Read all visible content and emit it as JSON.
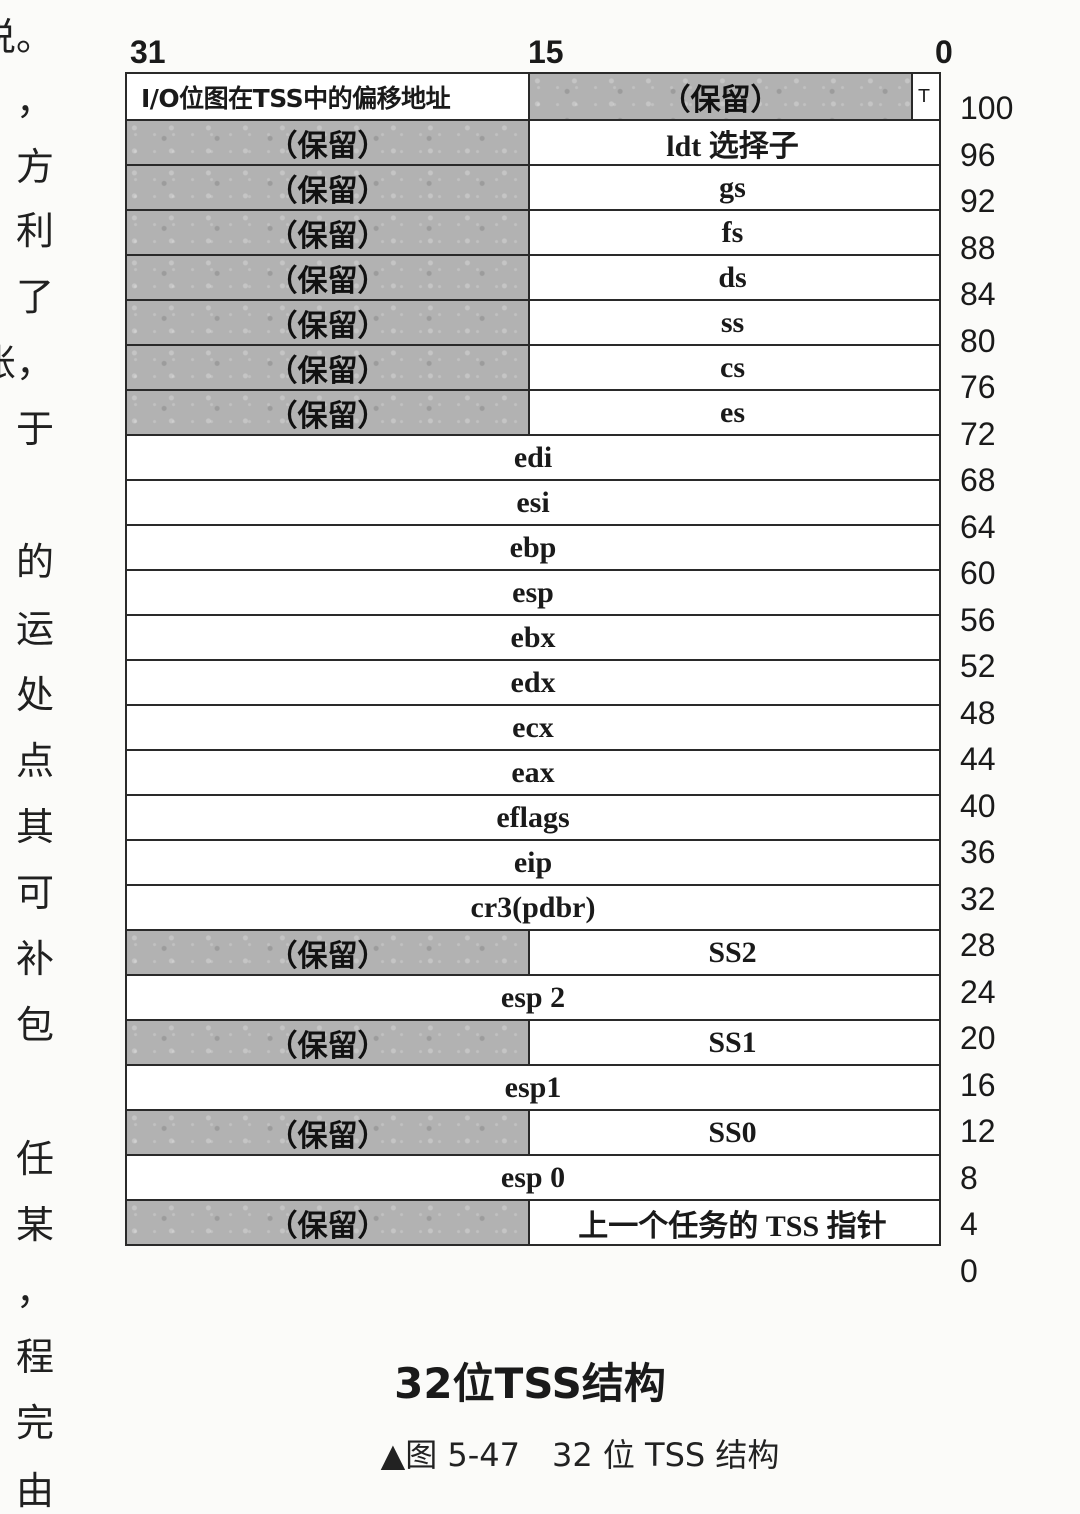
{
  "margin_text": [
    "说。",
    "，",
    "方",
    "利",
    "了",
    "账，",
    "于",
    "的",
    "运",
    "处",
    "点",
    "其",
    "可",
    "补",
    "包",
    "任",
    "某",
    "，",
    "程",
    "完",
    "由"
  ],
  "bit_labels": {
    "high": "31",
    "mid": "15",
    "low": "0"
  },
  "rows": [
    {
      "offset": "100",
      "high": "I/O位图在TSS中的偏移地址",
      "low": "（保留）",
      "t_bit": "T"
    },
    {
      "offset": "96",
      "high": "（保留）",
      "low": "ldt 选择子"
    },
    {
      "offset": "92",
      "high": "（保留）",
      "low": "gs"
    },
    {
      "offset": "88",
      "high": "（保留）",
      "low": "fs"
    },
    {
      "offset": "84",
      "high": "（保留）",
      "low": "ds"
    },
    {
      "offset": "80",
      "high": "（保留）",
      "low": "ss"
    },
    {
      "offset": "76",
      "high": "（保留）",
      "low": "cs"
    },
    {
      "offset": "72",
      "high": "（保留）",
      "low": "es"
    },
    {
      "offset": "68",
      "full": "edi"
    },
    {
      "offset": "64",
      "full": "esi"
    },
    {
      "offset": "60",
      "full": "ebp"
    },
    {
      "offset": "56",
      "full": "esp"
    },
    {
      "offset": "52",
      "full": "ebx"
    },
    {
      "offset": "48",
      "full": "edx"
    },
    {
      "offset": "44",
      "full": "ecx"
    },
    {
      "offset": "40",
      "full": "eax"
    },
    {
      "offset": "36",
      "full": "eflags"
    },
    {
      "offset": "32",
      "full": "eip"
    },
    {
      "offset": "28",
      "full": "cr3(pdbr)"
    },
    {
      "offset": "24",
      "high": "（保留）",
      "low": "SS2"
    },
    {
      "offset": "20",
      "full": "esp 2"
    },
    {
      "offset": "16",
      "high": "（保留）",
      "low": "SS1"
    },
    {
      "offset": "12",
      "full": "esp1"
    },
    {
      "offset": "8",
      "high": "（保留）",
      "low": "SS0"
    },
    {
      "offset": "4",
      "full": "esp 0"
    },
    {
      "offset": "0",
      "high": "（保留）",
      "low": "上一个任务的 TSS 指针"
    }
  ],
  "figure_title": "32位TSS结构",
  "figure_caption": "▲图 5-47　32 位 TSS 结构",
  "colors": {
    "reserved_fill": "#b2b2b2",
    "border": "#2a2a2a"
  }
}
